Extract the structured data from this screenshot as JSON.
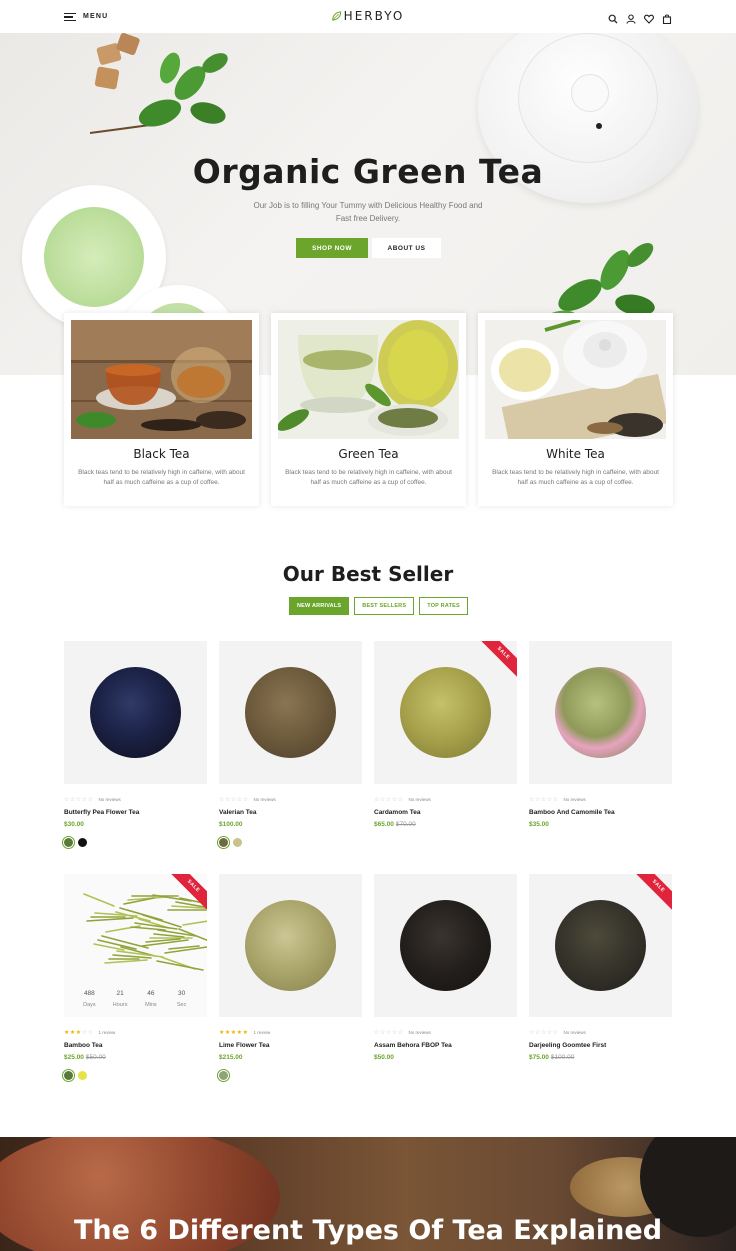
{
  "header": {
    "menu_label": "MENU",
    "logo": "HERBYO",
    "icons": [
      "search-icon",
      "user-icon",
      "heart-icon",
      "bag-icon"
    ]
  },
  "hero": {
    "title": "Organic Green Tea",
    "subtitle": "Our Job is to filling Your Tummy with Delicious Healthy Food and Fast free Delivery.",
    "shop_button": "SHOP NOW",
    "about_button": "ABOUT US"
  },
  "categories": [
    {
      "title": "Black Tea",
      "desc": "Black teas tend to be relatively high in caffeine, with about half as much caffeine as a cup of coffee."
    },
    {
      "title": "Green Tea",
      "desc": "Black teas tend to be relatively high in caffeine, with about half as much caffeine as a cup of coffee."
    },
    {
      "title": "White Tea",
      "desc": "Black teas tend to be relatively high in caffeine, with about half as much caffeine as a cup of coffee."
    }
  ],
  "best_seller": {
    "title": "Our Best Seller",
    "tabs": [
      "NEW ARRIVALS",
      "BEST SELLERS",
      "TOP RATES"
    ],
    "sale_label": "SALE",
    "products": [
      {
        "name": "Butterfly Pea Flower Tea",
        "price": "$30.00",
        "old_price": "",
        "reviews": "No reviews",
        "rating": 0
      },
      {
        "name": "Valerian Tea",
        "price": "$100.00",
        "old_price": "",
        "reviews": "No reviews",
        "rating": 0
      },
      {
        "name": "Cardamom Tea",
        "price": "$65.00",
        "old_price": "$70.00",
        "reviews": "No reviews",
        "rating": 0
      },
      {
        "name": "Bamboo And Camomile Tea",
        "price": "$35.00",
        "old_price": "",
        "reviews": "No reviews",
        "rating": 0
      },
      {
        "name": "Bamboo Tea",
        "price": "$25.00",
        "old_price": "$50.00",
        "reviews": "1 review",
        "rating": 3
      },
      {
        "name": "Lime Flower Tea",
        "price": "$215.00",
        "old_price": "",
        "reviews": "1 review",
        "rating": 5
      },
      {
        "name": "Assam Behora FBOP Tea",
        "price": "$50.00",
        "old_price": "",
        "reviews": "No reviews",
        "rating": 0
      },
      {
        "name": "Darjeeling Goomtee First",
        "price": "$75.00",
        "old_price": "$100.00",
        "reviews": "No reviews",
        "rating": 0
      }
    ],
    "countdown": [
      {
        "value": "488",
        "label": "Days"
      },
      {
        "value": "21",
        "label": "Hours"
      },
      {
        "value": "46",
        "label": "Mins"
      },
      {
        "value": "30",
        "label": "Sec"
      }
    ]
  },
  "banner": {
    "title": "The 6 Different Types Of Tea Explained"
  },
  "colors": {
    "accent": "#6ba52c",
    "sale": "#e0243b",
    "star": "#f0b400"
  }
}
